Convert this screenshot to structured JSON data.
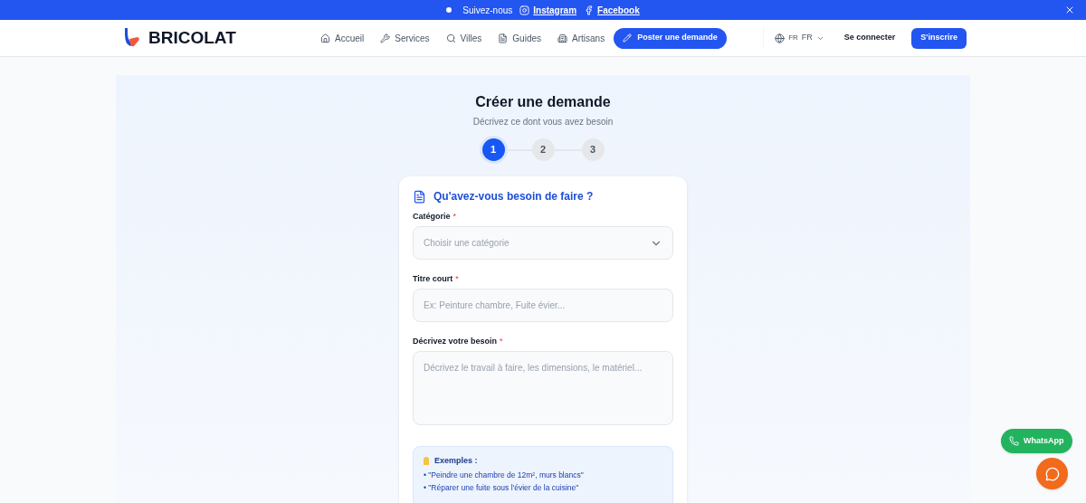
{
  "banner": {
    "label": "Suivez-nous",
    "links": [
      "Instagram",
      "Facebook"
    ]
  },
  "header": {
    "brand": "BRICOLAT",
    "nav": [
      {
        "label": "Accueil"
      },
      {
        "label": "Services"
      },
      {
        "label": "Villes"
      },
      {
        "label": "Guides"
      },
      {
        "label": "Artisans"
      }
    ],
    "cta": "Poster une demande",
    "language": {
      "code": "FR",
      "label": "FR"
    },
    "login": "Se connecter",
    "signup": "S'inscrire"
  },
  "page": {
    "title": "Créer une demande",
    "subtitle": "Décrivez ce dont vous avez besoin",
    "steps": [
      {
        "label": "1",
        "selected": true
      },
      {
        "label": "2",
        "selected": false
      },
      {
        "label": "3",
        "selected": false
      }
    ],
    "form": {
      "heading": "Qu'avez-vous besoin de faire ?",
      "required_mark": "*",
      "fields": [
        {
          "kind": "select",
          "label": "Catégorie",
          "required": true,
          "placeholder": "Choisir une catégorie"
        },
        {
          "kind": "text",
          "label": "Titre court",
          "required": true,
          "placeholder": "Ex: Peinture chambre, Fuite évier..."
        },
        {
          "kind": "textarea",
          "label": "Décrivez votre besoin",
          "required": true,
          "placeholder": "Décrivez le travail à faire, les dimensions, le matériel..."
        }
      ],
      "examples": {
        "title": "Exemples :",
        "items": [
          "• \"Peindre une chambre de 12m², murs blancs\"",
          "• \"Réparer une fuite sous l'évier de la cuisine\""
        ]
      }
    }
  },
  "whatsapp": "WhatsApp"
}
